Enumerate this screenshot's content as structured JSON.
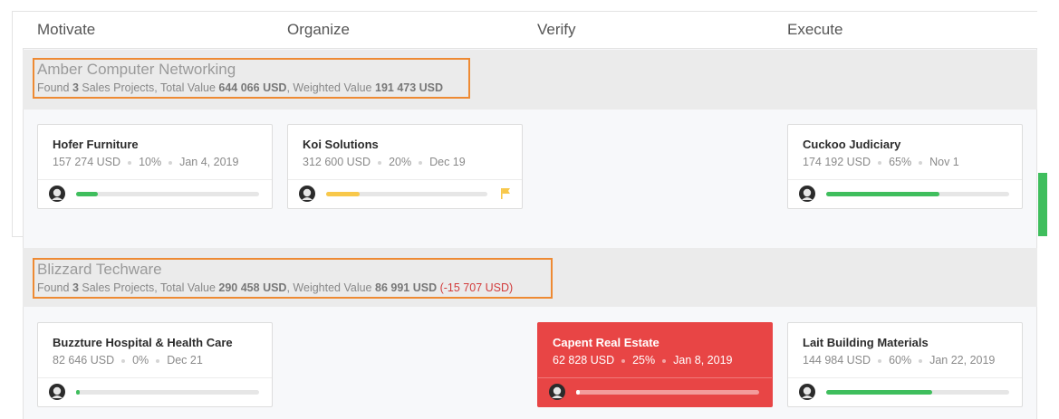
{
  "stages": [
    "Motivate",
    "Organize",
    "Verify",
    "Execute"
  ],
  "colors": {
    "accent_orange": "#ee8a33",
    "progress_green": "#3fbe5d",
    "progress_yellow": "#f8c84a",
    "danger_red": "#e84545"
  },
  "groups": [
    {
      "title": "Amber Computer Networking",
      "summary": {
        "found_prefix": "Found",
        "count": "3",
        "mid1": "Sales Projects, Total Value",
        "total_value": "644 066 USD",
        "mid2": ", Weighted Value",
        "weighted_value": "191 473 USD",
        "delta": ""
      },
      "cards": [
        {
          "name": "Hofer Furniture",
          "value": "157 274 USD",
          "probability": "10%",
          "date": "Jan 4, 2019",
          "progress": 0.12,
          "progress_color": "#3fbe5d",
          "avatar_icon": "user-avatar-icon"
        },
        {
          "name": "Koi Solutions",
          "value": "312 600 USD",
          "probability": "20%",
          "date": "Dec 19",
          "progress": 0.21,
          "progress_color": "#f8c84a",
          "flag": true,
          "avatar_icon": "user-avatar-icon"
        },
        {
          "name": "Cuckoo Judiciary",
          "value": "174 192 USD",
          "probability": "65%",
          "date": "Nov 1",
          "progress": 0.62,
          "progress_color": "#3fbe5d",
          "avatar_icon": "user-avatar-icon"
        }
      ]
    },
    {
      "title": "Blizzard Techware",
      "summary": {
        "found_prefix": "Found",
        "count": "3",
        "mid1": "Sales Projects, Total Value",
        "total_value": "290 458 USD",
        "mid2": ", Weighted Value",
        "weighted_value": "86 991 USD",
        "delta": "(-15 707 USD)"
      },
      "cards": [
        {
          "name": "Buzzture Hospital & Health Care",
          "value": "82 646 USD",
          "probability": "0%",
          "date": "Dec 21",
          "progress": 0.02,
          "progress_color": "#3fbe5d",
          "avatar_icon": "user-avatar-icon"
        },
        {
          "name": "Capent Real Estate",
          "value": "62 828 USD",
          "probability": "25%",
          "date": "Jan 8, 2019",
          "progress": 0.02,
          "progress_color": "#ffffff",
          "avatar_icon": "user-avatar-icon"
        },
        {
          "name": "Lait Building Materials",
          "value": "144 984 USD",
          "probability": "60%",
          "date": "Jan 22, 2019",
          "progress": 0.58,
          "progress_color": "#3fbe5d",
          "avatar_icon": "user-avatar-icon"
        }
      ]
    }
  ]
}
